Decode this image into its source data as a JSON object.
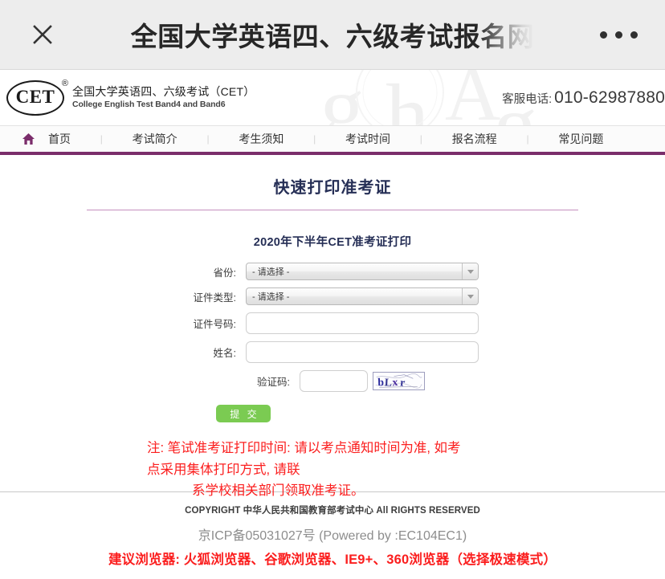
{
  "browser_bar": {
    "close_icon": "close-icon",
    "title": "全国大学英语四、六级考试报名网",
    "more_icon": "more-options-icon"
  },
  "site_header": {
    "logo_mark": "CET",
    "logo_registered": "®",
    "logo_cn": "全国大学英语四、六级考试（CET）",
    "logo_en": "College English Test Band4 and Band6",
    "hotline_label": "客服电话:",
    "hotline_number": "010-62987880"
  },
  "nav": {
    "home_icon": "home-icon",
    "separator": "|",
    "items": [
      {
        "label": "首页"
      },
      {
        "label": "考试简介"
      },
      {
        "label": "考生须知"
      },
      {
        "label": "考试时间"
      },
      {
        "label": "报名流程"
      },
      {
        "label": "常见问题"
      }
    ]
  },
  "main": {
    "page_title": "快速打印准考证",
    "sub_title": "2020年下半年CET准考证打印",
    "form": {
      "province": {
        "label": "省份:",
        "value": "- 请选择 -"
      },
      "id_type": {
        "label": "证件类型:",
        "value": "- 请选择 -"
      },
      "id_number": {
        "label": "证件号码:",
        "value": "",
        "placeholder": ""
      },
      "name": {
        "label": "姓名:",
        "value": "",
        "placeholder": ""
      },
      "captcha": {
        "label": "验证码:",
        "value": "",
        "placeholder": "",
        "image_text": "bLxr"
      },
      "submit_label": "提 交"
    },
    "notice": {
      "line1": "注: 笔试准考证打印时间: 请以考点通知时间为准, 如考",
      "line2": "点采用集体打印方式, 请联",
      "line3": "系学校相关部门领取准考证。"
    }
  },
  "footer": {
    "copyright": "COPYRIGHT 中华人民共和国教育部考试中心 All RIGHTS RESERVED",
    "icp": "京ICP备05031027号 (Powered by :EC104EC1)",
    "browser_tip": "建议浏览器: 火狐浏览器、谷歌浏览器、IE9+、360浏览器（选择极速模式）"
  },
  "colors": {
    "nav_accent": "#7b2d6b",
    "title_navy": "#262f56",
    "warning_red": "#fb1e1e",
    "submit_green": "#7bcb52",
    "rule_purple": "#c58fbe"
  }
}
